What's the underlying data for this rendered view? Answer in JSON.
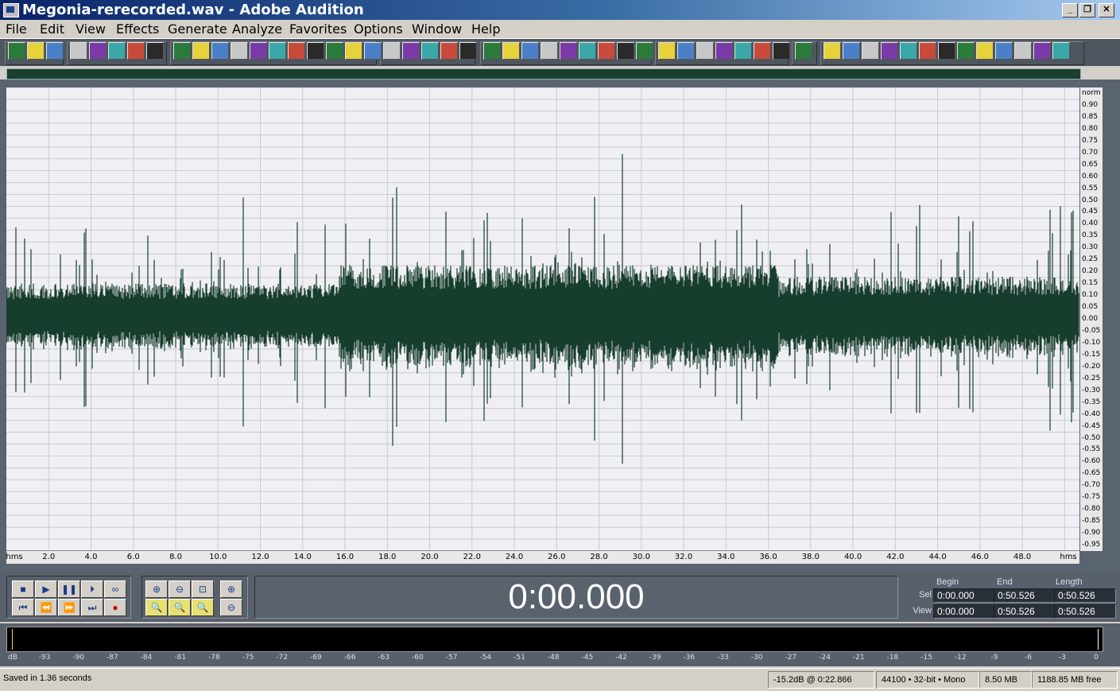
{
  "window": {
    "title": "Megonia-rerecorded.wav - Adobe Audition"
  },
  "menu": [
    "File",
    "Edit",
    "View",
    "Effects",
    "Generate",
    "Analyze",
    "Favorites",
    "Options",
    "Window",
    "Help"
  ],
  "waveform": {
    "y_ticks": [
      "norm",
      "0.90",
      "0.85",
      "0.80",
      "0.75",
      "0.70",
      "0.65",
      "0.60",
      "0.55",
      "0.50",
      "0.45",
      "0.40",
      "0.35",
      "0.30",
      "0.25",
      "0.20",
      "0.15",
      "0.10",
      "0.05",
      "0.00",
      "-0.05",
      "-0.10",
      "-0.15",
      "-0.20",
      "-0.25",
      "-0.30",
      "-0.35",
      "-0.40",
      "-0.45",
      "-0.50",
      "-0.55",
      "-0.60",
      "-0.65",
      "-0.70",
      "-0.75",
      "-0.80",
      "-0.85",
      "-0.90",
      "-0.95"
    ],
    "x_unit_left": "hms",
    "x_unit_right": "hms",
    "x_ticks": [
      "2.0",
      "4.0",
      "6.0",
      "8.0",
      "10.0",
      "12.0",
      "14.0",
      "16.0",
      "18.0",
      "20.0",
      "22.0",
      "24.0",
      "26.0",
      "28.0",
      "30.0",
      "32.0",
      "34.0",
      "36.0",
      "38.0",
      "40.0",
      "42.0",
      "44.0",
      "46.0",
      "48.0"
    ],
    "wave_color": "#173d2c",
    "background_color": "#f0f0f4"
  },
  "transport": {
    "time_display": "0:00.000",
    "sel_headers": {
      "begin": "Begin",
      "end": "End",
      "length": "Length"
    },
    "sel_label": "Sel",
    "view_label": "View",
    "sel": {
      "begin": "0:00.000",
      "end": "0:50.526",
      "length": "0:50.526"
    },
    "view": {
      "begin": "0:00.000",
      "end": "0:50.526",
      "length": "0:50.526"
    }
  },
  "level_meter": {
    "unit": "dB",
    "ticks": [
      "-93",
      "-90",
      "-87",
      "-84",
      "-81",
      "-78",
      "-75",
      "-72",
      "-69",
      "-66",
      "-63",
      "-60",
      "-57",
      "-54",
      "-51",
      "-48",
      "-45",
      "-42",
      "-39",
      "-36",
      "-33",
      "-30",
      "-27",
      "-24",
      "-21",
      "-18",
      "-15",
      "-12",
      "-9",
      "-6",
      "-3",
      "0"
    ]
  },
  "status": {
    "message": "Saved in 1.36 seconds",
    "cursor_level": "-15.2dB @   0:22.866",
    "format": "44100 • 32-bit • Mono",
    "file_size": "8.50 MB",
    "free_space": "1188.85 MB free"
  }
}
